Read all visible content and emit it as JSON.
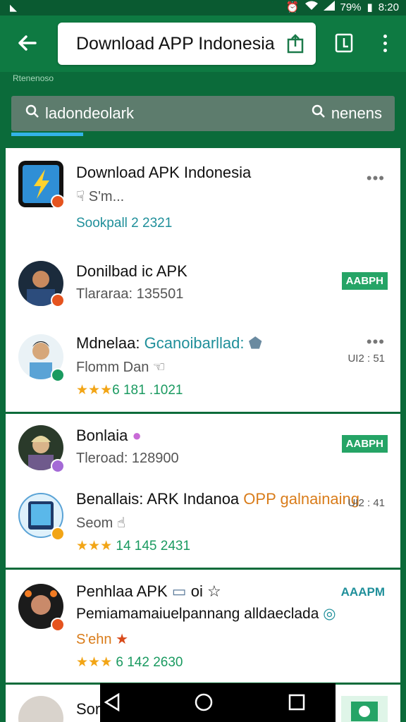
{
  "status": {
    "battery": "79%",
    "time": "8:20"
  },
  "app_bar": {
    "url": "Download APP Indonesia"
  },
  "sub_label": "Rtenenoso",
  "search": {
    "left_text": "ladondeolark",
    "right_text": "nenens"
  },
  "items": [
    {
      "title": "Download APK Indonesia",
      "subtitle": "S'm...",
      "meta": "Sookpall 2 2321"
    },
    {
      "title": "Donilbad ic APK",
      "subtitle": "Tlararaa: 135501",
      "tag": "AABPH"
    },
    {
      "title_prefix": "Mdnelaa:",
      "title_colored": "Gcanoibarllad:",
      "subtitle": "Flomm Dan",
      "stars": "★★★",
      "meta": "6 181 .1021",
      "time": "UI2 : 51"
    },
    {
      "title": "Bonlaia",
      "subtitle": "Tleroad: 128900",
      "tag": "AABPH"
    },
    {
      "title_prefix": "Benallais: ARK Indanoa",
      "title_colored": "OPP galnainaing",
      "subtitle": "Seom",
      "stars": "★★★",
      "meta": "14 145 2431",
      "time": "UI2 : 41"
    },
    {
      "title_prefix": "Penhlaa APK",
      "title_suffix": "oi",
      "time_label": "AAAPM",
      "subtitle": "Pemiamamaiuelpannang alldaeclada",
      "sub2": "S'ehn",
      "stars": "★★★",
      "meta": "6 142 2630"
    },
    {
      "title": "Sor"
    }
  ],
  "colors": {
    "header": "#0e7a42",
    "tag": "#25a466",
    "search_underline": "#33b3e8",
    "star": "#f2a516"
  }
}
